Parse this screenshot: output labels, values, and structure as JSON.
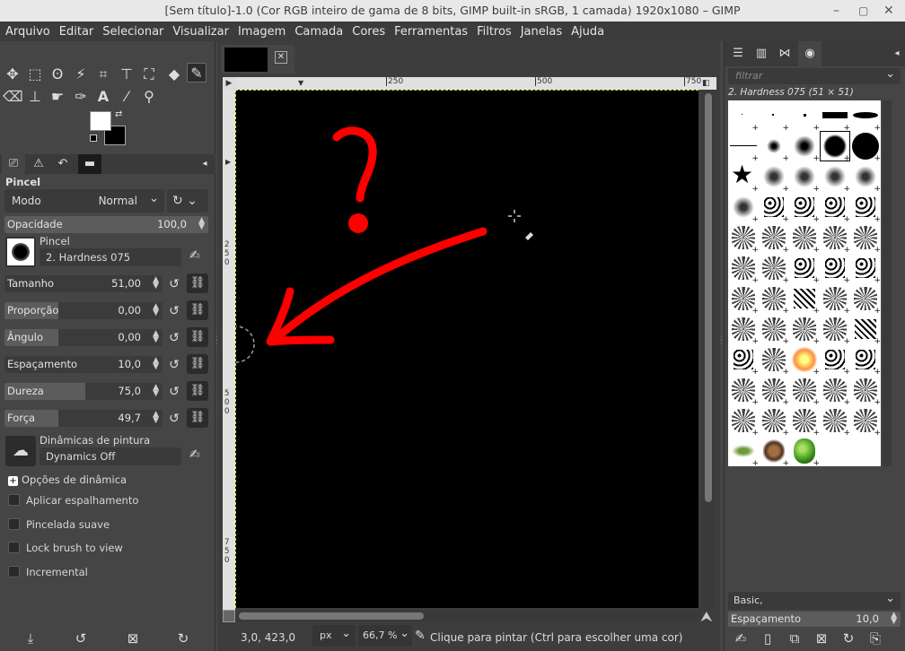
{
  "window": {
    "title": "[Sem título]-1.0 (Cor RGB inteiro de gama de 8 bits, GIMP built-in sRGB, 1 camada) 1920x1080 – GIMP"
  },
  "menu": [
    "Arquivo",
    "Editar",
    "Selecionar",
    "Visualizar",
    "Imagem",
    "Camada",
    "Cores",
    "Ferramentas",
    "Filtros",
    "Janelas",
    "Ajuda"
  ],
  "tool_options": {
    "title": "Pincel",
    "mode_label": "Modo",
    "mode_value": "Normal",
    "opacity": {
      "label": "Opacidade",
      "value": "100,0",
      "fraction": 1.0
    },
    "brush_label": "Pincel",
    "brush_name": "2. Hardness 075",
    "sliders": [
      {
        "label": "Tamanho",
        "value": "51,00",
        "fraction": 0.0
      },
      {
        "label": "Proporção",
        "value": "0,00",
        "fraction": 0.34
      },
      {
        "label": "Ângulo",
        "value": "0,00",
        "fraction": 0.34
      },
      {
        "label": "Espaçamento",
        "value": "10,0",
        "fraction": 0.0
      },
      {
        "label": "Dureza",
        "value": "75,0",
        "fraction": 0.51
      },
      {
        "label": "Força",
        "value": "49,7",
        "fraction": 0.34
      }
    ],
    "dynamics_label": "Dinâmicas de pintura",
    "dynamics_value": "Dynamics Off",
    "dynamics_options": "Opções de dinâmica",
    "checks": [
      "Aplicar espalhamento",
      "Pincelada suave",
      "Lock brush to view",
      "Incremental"
    ]
  },
  "ruler": {
    "top": [
      "250",
      "500",
      "750"
    ],
    "left": [
      "2\n5\n0",
      "5\n0\n0",
      "7\n5\n0"
    ]
  },
  "status": {
    "coords": "3,0, 423,0",
    "unit": "px",
    "zoom": "66,7 %",
    "message": "Clique para pintar (Ctrl para escolher uma cor)"
  },
  "brushes": {
    "filter_placeholder": "filtrar",
    "selected": "2. Hardness 075 (51 × 51)",
    "tag": "Basic,",
    "spacing_label": "Espaçamento",
    "spacing_value": "10,0"
  },
  "colors": {
    "accent_red": "#ff0000",
    "canvas": "#000000"
  }
}
